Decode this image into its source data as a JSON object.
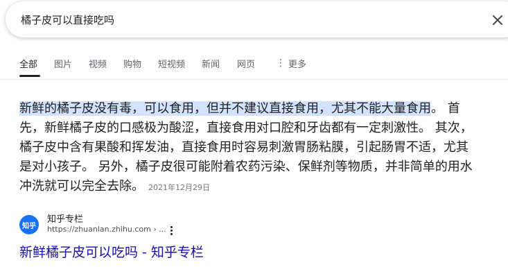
{
  "search": {
    "query": "橘子皮可以直接吃吗"
  },
  "tabs": [
    {
      "label": "全部"
    },
    {
      "label": "图片"
    },
    {
      "label": "视频"
    },
    {
      "label": "购物"
    },
    {
      "label": "短视频"
    },
    {
      "label": "新闻"
    },
    {
      "label": "网页"
    },
    {
      "label": "更多"
    }
  ],
  "snippet": {
    "highlighted": "新鲜的橘子皮没有毒，可以食用，但并不建议直接食用，尤其不能大量食用",
    "rest": "。 首先，新鲜橘子皮的口感极为酸涩，直接食用对口腔和牙齿都有一定刺激性。 其次，橘子皮中含有果酸和挥发油，直接食用时容易刺激胃肠粘膜，引起肠胃不适，尤其是对小孩子。 另外，橘子皮很可能附着农药污染、保鲜剂等物质，并非简单的用水冲洗就可以完全去除。",
    "date": "2021年12月29日"
  },
  "source": {
    "favicon_text": "知乎",
    "name": "知乎专栏",
    "url": "https://zhuanlan.zhihu.com › ..."
  },
  "result": {
    "title": "新鲜橘子皮可以吃吗 - 知乎专栏"
  },
  "colors": {
    "link": "#1a0dab",
    "highlight": "#d3e3fd",
    "favicon_bg": "#1772f6"
  }
}
